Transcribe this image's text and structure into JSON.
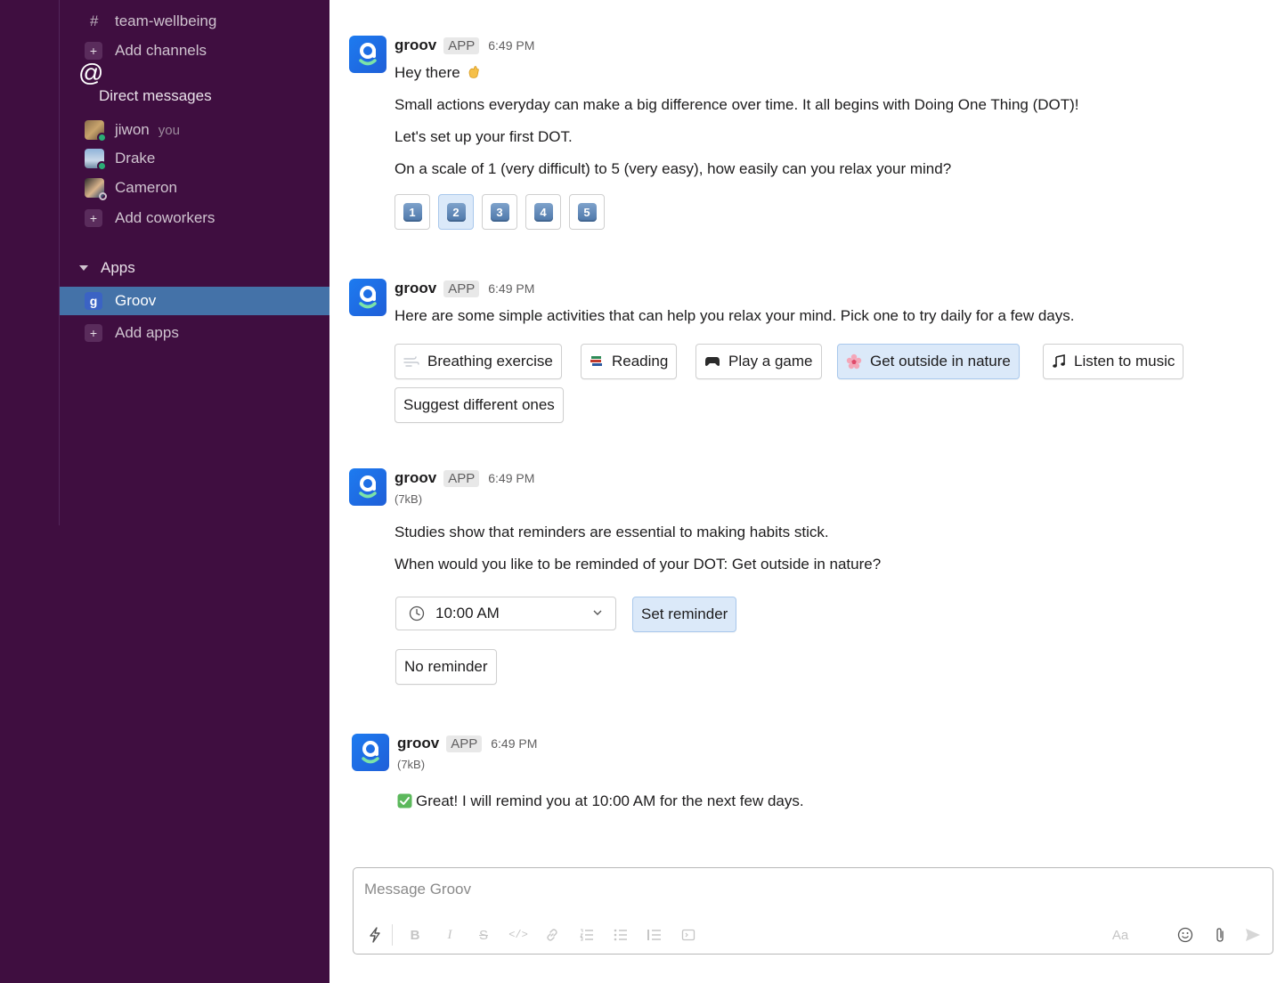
{
  "sidebar": {
    "channel_name": "team-wellbeing",
    "add_channels": "Add channels",
    "dm_section": "Direct messages",
    "dms": [
      {
        "name": "jiwon",
        "suffix": "you"
      },
      {
        "name": "Drake"
      },
      {
        "name": "Cameron"
      }
    ],
    "add_coworkers": "Add coworkers",
    "apps_section": "Apps",
    "apps": [
      {
        "name": "Groov",
        "icon_letter": "g"
      }
    ],
    "add_apps": "Add apps"
  },
  "messages": [
    {
      "sender": "groov",
      "badge": "APP",
      "time": "6:49 PM",
      "greeting": "Hey there",
      "lines": [
        "Small actions everyday can make a big difference over time. It all begins with Doing One Thing (DOT)!",
        "Let's set up your first DOT.",
        "On a scale of 1 (very difficult) to 5 (very easy), how easily can you relax your mind?"
      ],
      "scale": [
        "1",
        "2",
        "3",
        "4",
        "5"
      ],
      "selected_scale": "2"
    },
    {
      "sender": "groov",
      "badge": "APP",
      "time": "6:49 PM",
      "text": "Here are some simple activities that can help you relax your mind. Pick one to try daily for a few days.",
      "options": [
        {
          "label": "Breathing exercise",
          "icon": "wind-icon"
        },
        {
          "label": "Reading",
          "icon": "books-icon"
        },
        {
          "label": "Play a game",
          "icon": "gamepad-icon"
        },
        {
          "label": "Get outside in nature",
          "icon": "flower-icon",
          "selected": true
        },
        {
          "label": "Listen to music",
          "icon": "music-note-icon"
        }
      ],
      "suggest_label": "Suggest different ones"
    },
    {
      "sender": "groov",
      "badge": "APP",
      "time": "6:49 PM",
      "size": "(7kB)",
      "lines": [
        "Studies show that reminders are essential to making habits stick.",
        "When would you like to be reminded of your DOT: Get outside in nature?"
      ],
      "time_select": "10:00 AM",
      "set_reminder": "Set reminder",
      "no_reminder": "No reminder"
    },
    {
      "sender": "groov",
      "badge": "APP",
      "time": "6:49 PM",
      "size": "(7kB)",
      "text": "Great! I will remind you at 10:00 AM for the next few days."
    }
  ],
  "composer": {
    "placeholder": "Message Groov",
    "format_label": "Aa"
  },
  "colors": {
    "sidebar_bg": "#3f0e40",
    "sidebar_active": "#4472a8",
    "selected_button": "#dbe9f9",
    "bot_blue": "#1d7bf0"
  }
}
